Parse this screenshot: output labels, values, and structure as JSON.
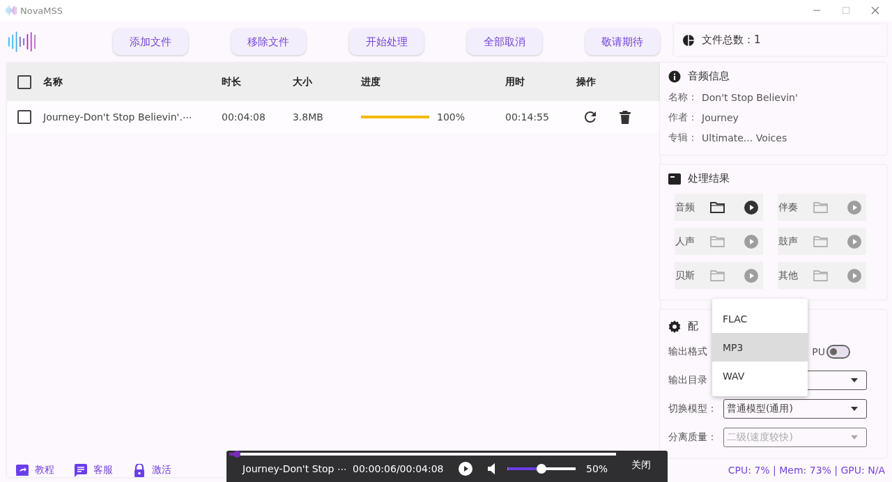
{
  "window": {
    "title": "NovaMSS"
  },
  "toolbar": {
    "buttons": [
      "添加文件",
      "移除文件",
      "开始处理",
      "全部取消",
      "敬请期待"
    ]
  },
  "table": {
    "select_all": {
      "checked": false
    },
    "columns": [
      "名称",
      "时长",
      "大小",
      "进度",
      "用时",
      "操作"
    ],
    "rows": [
      {
        "checked": false,
        "name": "Journey-Don't Stop Believin'.⋯",
        "duration": "00:04:08",
        "size": "3.8MB",
        "level": 1,
        "progress": "100%",
        "elapsed": "00:14:55"
      }
    ]
  },
  "stats": {
    "label": "文件总数：",
    "value": "1"
  },
  "audio_info": {
    "title": "音频信息",
    "fields": [
      {
        "label": "名称：",
        "value": "Don't Stop Believin'"
      },
      {
        "label": "作者：",
        "value": "Journey"
      },
      {
        "label": "专辑：",
        "value": "Ultimate... Voices"
      }
    ]
  },
  "results": {
    "title": "处理结果",
    "items": [
      {
        "label": "音频",
        "enabled": true
      },
      {
        "label": "伴奏",
        "enabled": false
      },
      {
        "label": "人声",
        "enabled": false
      },
      {
        "label": "鼓声",
        "enabled": false
      },
      {
        "label": "贝斯",
        "enabled": false
      },
      {
        "label": "其他",
        "enabled": false
      }
    ]
  },
  "config": {
    "title": "配",
    "format_label": "输出格式",
    "gpu_label": "PU",
    "gpu_on": false,
    "dir_label": "输出目录",
    "model_label": "切换模型：",
    "model_value": "普通模型(通用)",
    "quality_label": "分离质量：",
    "quality_value": "二级(速度较快)",
    "quality_disabled": true
  },
  "dropdown": {
    "options": [
      {
        "label": "FLAC",
        "selected": false
      },
      {
        "label": "MP3",
        "selected": true
      },
      {
        "label": "WAV",
        "selected": false
      }
    ]
  },
  "player": {
    "seek": {
      "level": 0.02
    },
    "title": "Journey-Don't Stop ⋯",
    "time": "00:00:06/00:04:08",
    "volume": {
      "level": 0.5,
      "text": "50%"
    },
    "close": "关闭"
  },
  "footer": {
    "links": [
      "教程",
      "客服",
      "激活"
    ],
    "status": "CPU: 7% | Mem: 73% | GPU: N/A"
  }
}
